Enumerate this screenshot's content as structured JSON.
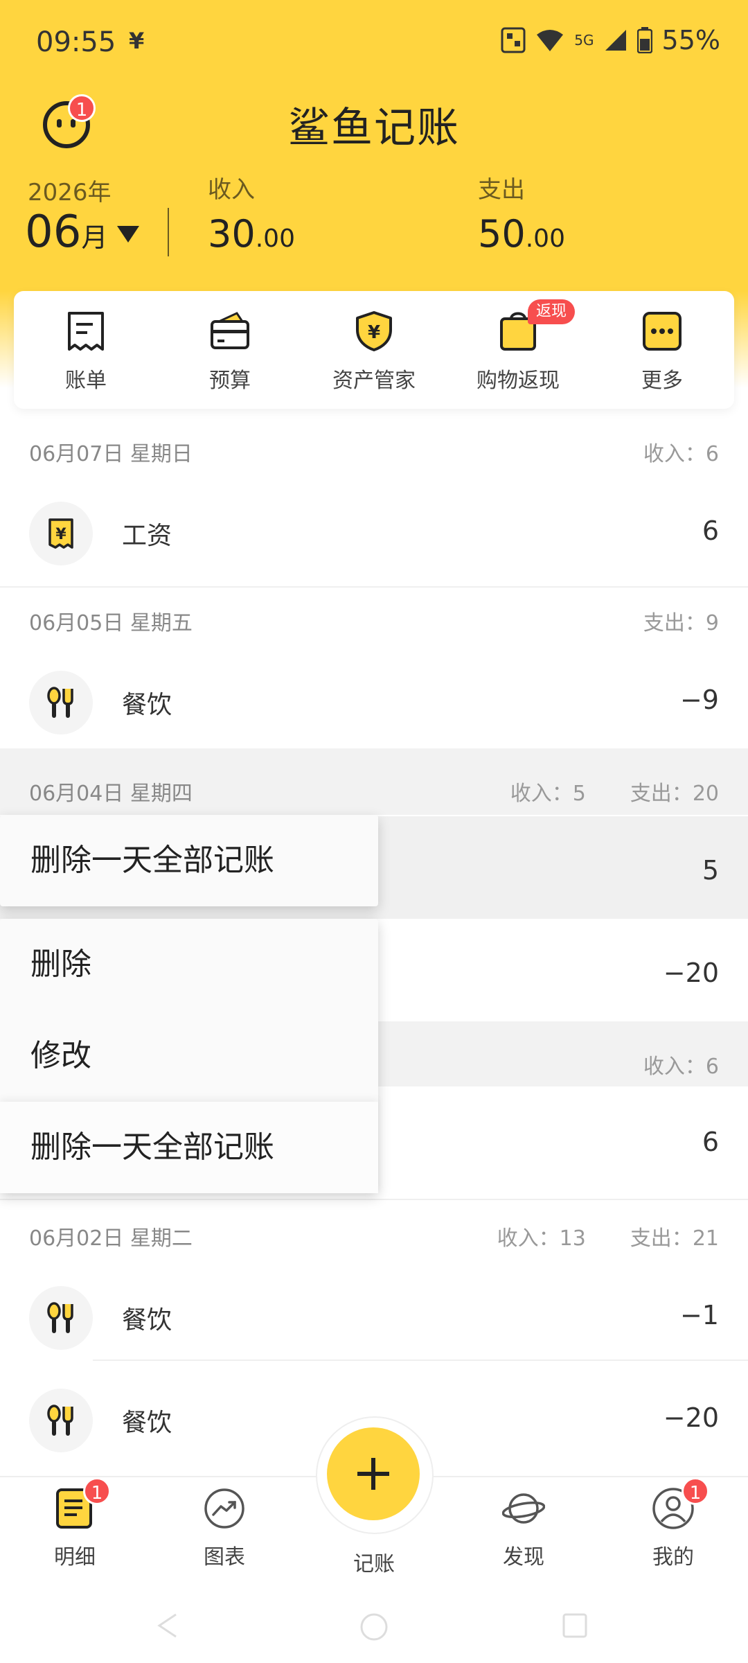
{
  "status_bar": {
    "time": "09:55",
    "yen_symbol": "¥",
    "network": "5G",
    "battery": "55%"
  },
  "header": {
    "title": "鲨鱼记账",
    "avatar_badge": "1",
    "year": "2026年",
    "month": "06",
    "month_unit": "月",
    "income_label": "收入",
    "income_int": "30",
    "income_dec": ".00",
    "expense_label": "支出",
    "expense_int": "50",
    "expense_dec": ".00"
  },
  "shortcuts": [
    {
      "label": "账单",
      "icon": "bill-icon"
    },
    {
      "label": "预算",
      "icon": "wallet-icon"
    },
    {
      "label": "资产管家",
      "icon": "shield-yen-icon"
    },
    {
      "label": "购物返现",
      "icon": "shopping-bag-icon",
      "badge": "返现"
    },
    {
      "label": "更多",
      "icon": "more-icon"
    }
  ],
  "days": [
    {
      "date": "06月07日 星期日",
      "summary": [
        {
          "label": "收入：",
          "value": "6"
        }
      ],
      "items": [
        {
          "name": "工资",
          "value": "6",
          "icon": "salary-icon"
        }
      ]
    },
    {
      "date": "06月05日 星期五",
      "summary": [
        {
          "label": "支出：",
          "value": "9"
        }
      ],
      "items": [
        {
          "name": "餐饮",
          "value": "−9",
          "icon": "dining-icon"
        }
      ]
    },
    {
      "date": "06月04日 星期四",
      "summary": [
        {
          "label": "收入：",
          "value": "5"
        },
        {
          "label": "支出：",
          "value": "20"
        }
      ],
      "items": [
        {
          "value": "5"
        },
        {
          "value": "−20"
        }
      ]
    },
    {
      "summary": [
        {
          "label": "收入：",
          "value": "6"
        }
      ],
      "items": [
        {
          "value": "6"
        }
      ]
    },
    {
      "date": "06月02日 星期二",
      "summary": [
        {
          "label": "收入：",
          "value": "13"
        },
        {
          "label": "支出：",
          "value": "21"
        }
      ],
      "items": [
        {
          "name": "餐饮",
          "value": "−1",
          "icon": "dining-icon"
        },
        {
          "name": "餐饮",
          "value": "−20",
          "icon": "dining-icon"
        }
      ]
    }
  ],
  "menu_top": {
    "delete_day": "删除一天全部记账"
  },
  "menu_bottom": {
    "delete": "删除",
    "edit": "修改",
    "delete_day": "删除一天全部记账"
  },
  "nav": [
    {
      "label": "明细",
      "icon": "detail-icon",
      "badge": "1"
    },
    {
      "label": "图表",
      "icon": "chart-icon"
    },
    {
      "label": "记账",
      "icon": "add-icon"
    },
    {
      "label": "发现",
      "icon": "planet-icon"
    },
    {
      "label": "我的",
      "icon": "profile-icon",
      "badge": "1"
    }
  ],
  "colors": {
    "brand_yellow": "#FFD53F",
    "badge_red": "#F74E4E"
  }
}
